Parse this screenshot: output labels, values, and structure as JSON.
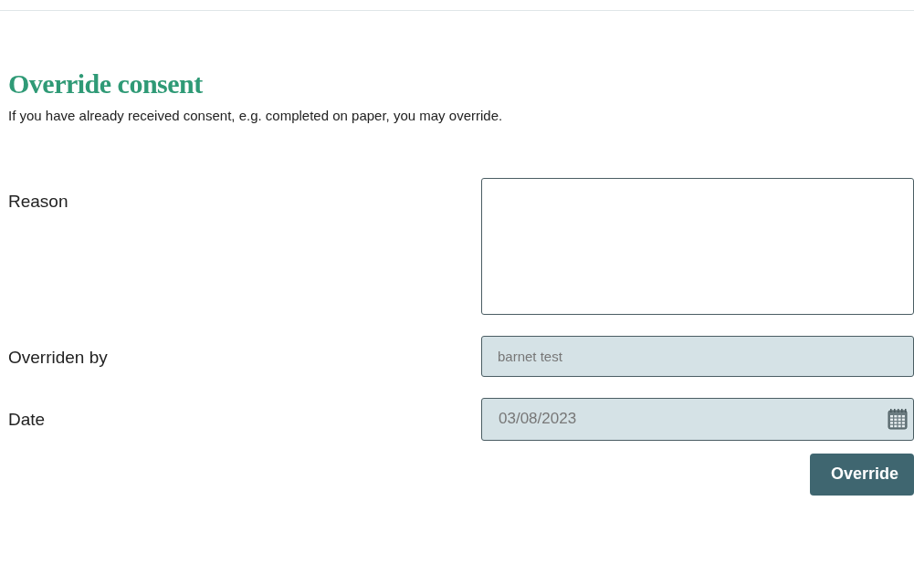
{
  "heading": "Override consent",
  "description": "If you have already received consent, e.g. completed on paper, you may override.",
  "fields": [
    {
      "kind": "textarea",
      "label": "Reason",
      "disabled": false
    },
    {
      "kind": "text",
      "label": "Overriden by",
      "value": "barnet test",
      "disabled": true
    },
    {
      "kind": "date",
      "label": "Date",
      "value": "03/08/2023",
      "disabled": true
    }
  ],
  "button": "Override"
}
